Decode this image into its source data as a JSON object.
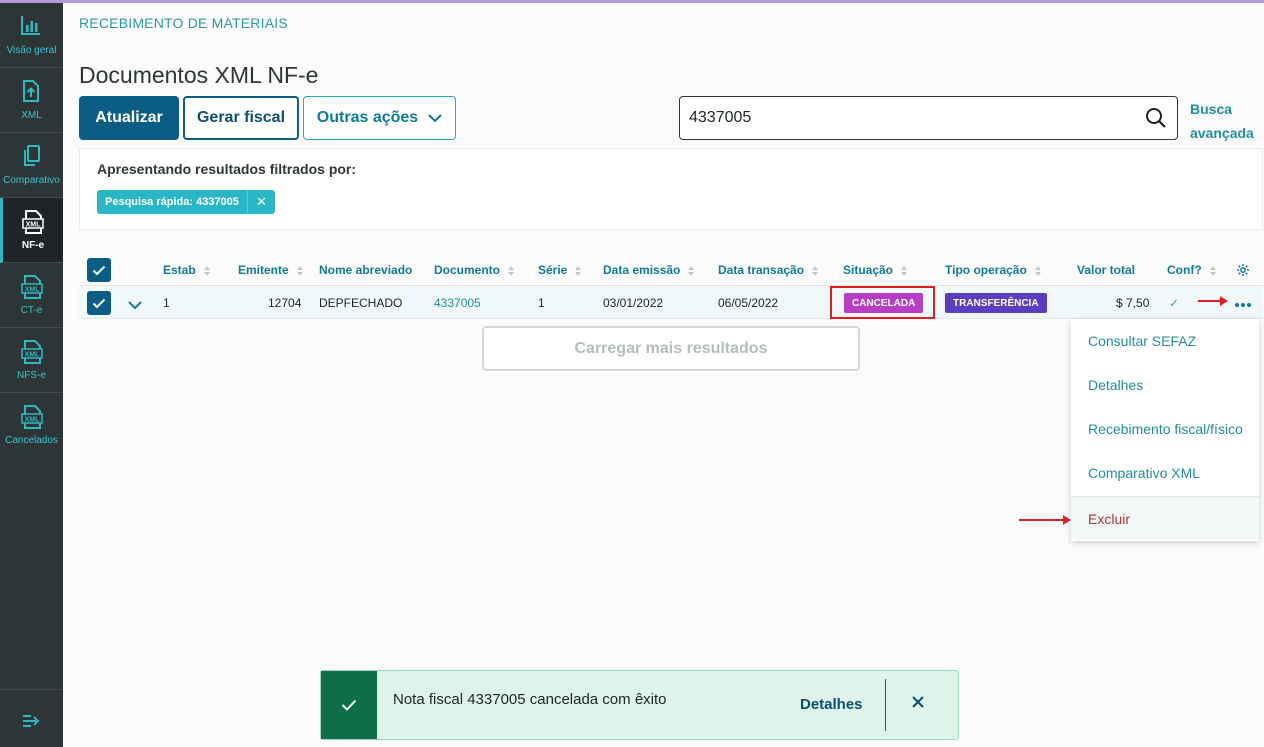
{
  "sidebar": {
    "items": [
      {
        "label": "Visão geral",
        "icon": "chart-icon"
      },
      {
        "label": "XML",
        "icon": "upload-file-icon"
      },
      {
        "label": "Comparativo",
        "icon": "copy-icon"
      },
      {
        "label": "NF-e",
        "icon": "xml-file-icon",
        "active": true
      },
      {
        "label": "CT-e",
        "icon": "xml-file-icon"
      },
      {
        "label": "NFS-e",
        "icon": "xml-file-icon"
      },
      {
        "label": "Cancelados",
        "icon": "xml-file-icon"
      }
    ]
  },
  "breadcrumb": "RECEBIMENTO DE MATERIAIS",
  "page_title": "Documentos XML NF-e",
  "toolbar": {
    "refresh_label": "Atualizar",
    "generate_label": "Gerar fiscal",
    "more_label": "Outras ações"
  },
  "search": {
    "value": "4337005",
    "advanced_label_1": "Busca",
    "advanced_label_2": "avançada"
  },
  "filters": {
    "title": "Apresentando resultados filtrados por:",
    "tag": "Pesquisa rápida: 4337005",
    "tag_close": "✕"
  },
  "table": {
    "headers": {
      "estab": "Estab",
      "emitente": "Emitente",
      "nome": "Nome abreviado",
      "documento": "Documento",
      "serie": "Série",
      "data_emissao": "Data emissão",
      "data_transacao": "Data transação",
      "situacao": "Situação",
      "tipo_operacao": "Tipo operação",
      "valor_total": "Valor total",
      "conf": "Conf?"
    },
    "rows": [
      {
        "estab": "1",
        "emitente": "12704",
        "nome": "DEPFECHADO",
        "documento": "4337005",
        "serie": "1",
        "data_emissao": "03/01/2022",
        "data_transacao": "06/05/2022",
        "situacao": "CANCELADA",
        "tipo_operacao": "TRANSFERÊNCIA",
        "valor_total": "$ 7,50",
        "conf": "✓"
      }
    ]
  },
  "load_more_label": "Carregar mais resultados",
  "row_menu": {
    "items": [
      "Consultar SEFAZ",
      "Detalhes",
      "Recebimento fiscal/físico",
      "Comparativo XML",
      "Excluir"
    ]
  },
  "toast": {
    "message": "Nota fiscal 4337005 cancelada com êxito",
    "action_label": "Detalhes"
  },
  "colors": {
    "primary": "#0c5d86",
    "accent": "#29b6c5",
    "sidebar_bg": "#2e3536",
    "cancel_badge": "#b63ec2",
    "operation_badge": "#5a3ec0",
    "toast_bg": "#def4ea",
    "toast_icon_bg": "#0f6e4a",
    "danger": "#b5332e"
  }
}
